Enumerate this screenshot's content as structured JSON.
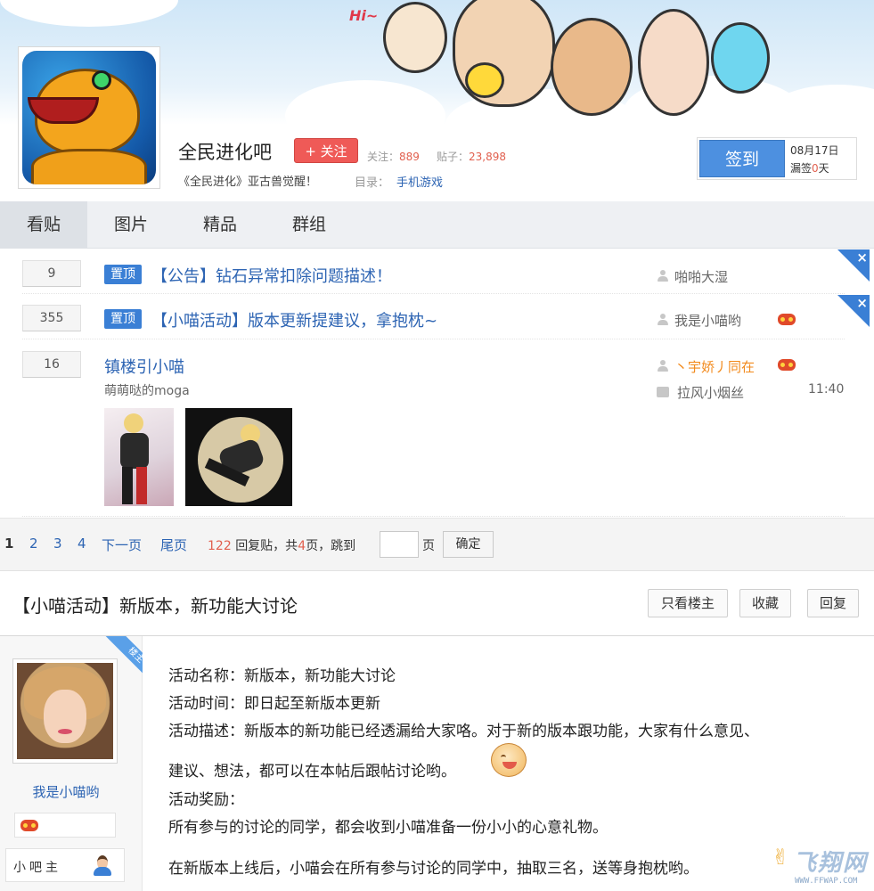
{
  "banner": {
    "greeting": "Hi~"
  },
  "forum": {
    "name": "全民进化吧",
    "follow_label": "+ 关注",
    "followers_label": "关注：",
    "followers_value": "889",
    "posts_label": "贴子：",
    "posts_value": "23,898",
    "slogan": "《全民进化》亚古兽觉醒！",
    "dir_label": "目录：",
    "dir_value": "手机游戏"
  },
  "sign": {
    "button": "签到",
    "date": "08月17日",
    "missed_prefix": "漏签",
    "missed_value": "0",
    "missed_suffix": "天"
  },
  "tabs": [
    "看贴",
    "图片",
    "精品",
    "群组"
  ],
  "threads": [
    {
      "replies": "9",
      "tag": "置顶",
      "title": "【公告】钻石异常扣除问题描述！",
      "author": "啪啪大湿"
    },
    {
      "replies": "355",
      "tag": "置顶",
      "title": "【小喵活动】版本更新提建议，拿抱枕~",
      "author": "我是小喵哟"
    },
    {
      "replies": "16",
      "title": "镇楼引小喵",
      "abstract": "萌萌哒的moga",
      "author": "丶宇娇丿同在",
      "last_reply": "拉风小烟丝",
      "time": "11:40"
    }
  ],
  "pager": {
    "pages": [
      "1",
      "2",
      "3",
      "4"
    ],
    "next": "下一页",
    "last": "尾页",
    "reply_count": "122",
    "reply_text": "回复贴，共",
    "page_total": "4",
    "page_text": "页，跳到",
    "unit": "页",
    "confirm": "确定"
  },
  "post": {
    "title": "【小喵活动】新版本，新功能大讨论",
    "only_op": "只看楼主",
    "favorite": "收藏",
    "reply": "回复",
    "author": "我是小喵哟",
    "op_ribbon": "楼主",
    "role": "小吧主",
    "lines": [
      "活动名称：新版本，新功能大讨论",
      "活动时间：即日起至新版本更新",
      "活动描述：新版本的新功能已经透漏给大家咯。对于新的版本跟功能，大家有什么意见、",
      "建议、想法，都可以在本帖后跟帖讨论哟。",
      "活动奖励：",
      "所有参与的讨论的同学，都会收到小喵准备一份小小的心意礼物。",
      "在新版本上线后，小喵会在所有参与讨论的同学中，抽取三名，送等身抱枕哟。"
    ]
  },
  "watermark": {
    "text": "飞翔网",
    "url": "WWW.FFWAP.COM"
  },
  "colors": {
    "accent": "#2d64b3",
    "follow": "#ef5a57",
    "sign": "#4d90e0",
    "top_tag": "#3a7fd5"
  }
}
